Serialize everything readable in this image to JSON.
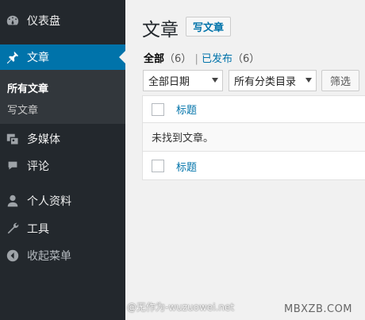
{
  "sidebar": {
    "items": [
      {
        "label": "仪表盘",
        "icon": "dashboard-icon"
      },
      {
        "label": "文章",
        "icon": "pushpin-icon"
      },
      {
        "label": "多媒体",
        "icon": "media-icon"
      },
      {
        "label": "评论",
        "icon": "comment-icon"
      },
      {
        "label": "个人资料",
        "icon": "user-icon"
      },
      {
        "label": "工具",
        "icon": "wrench-icon"
      },
      {
        "label": "收起菜单",
        "icon": "collapse-icon"
      }
    ],
    "submenu": [
      {
        "label": "所有文章"
      },
      {
        "label": "写文章"
      }
    ]
  },
  "main": {
    "title": "文章",
    "add_new_label": "写文章",
    "filters_links": {
      "all_label": "全部",
      "all_count": "（6）",
      "separator": "|",
      "published_label": "已发布",
      "published_count": "（6）"
    },
    "date_select": "全部日期",
    "category_select": "所有分类目录",
    "filter_button": "筛选",
    "table": {
      "header_title": "标题",
      "empty_message": "未找到文章。",
      "footer_title": "标题"
    }
  },
  "watermarks": {
    "weibo": "@无作为-wuzuowei.net",
    "site": "MBXZB.COM"
  },
  "colors": {
    "sidebar_bg": "#23282d",
    "active_bg": "#0073aa",
    "link": "#0073aa",
    "page_bg": "#f1f1f1"
  }
}
